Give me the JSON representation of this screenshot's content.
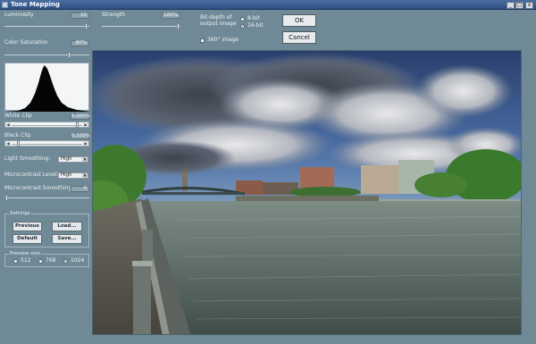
{
  "window": {
    "title": "Tone Mapping",
    "buttons": [
      "_",
      "□",
      "x"
    ]
  },
  "controls": {
    "luminosity": {
      "label": "Luminosity",
      "value": "10"
    },
    "color_saturation": {
      "label": "Color Saturation",
      "value": "80%"
    },
    "white_clip": {
      "label": "White Clip",
      "value": "5.000%"
    },
    "black_clip": {
      "label": "Black Clip",
      "value": "0.330%"
    },
    "light_smoothing": {
      "label": "Light Smoothing:",
      "value": "High"
    },
    "microcontrast_level": {
      "label": "Microcontrast Level:",
      "value": "High"
    },
    "microcontrast_smoothing": {
      "label": "Microcontrast Smoothing",
      "value": "0"
    },
    "strength": {
      "label": "Strength",
      "value": "100%"
    }
  },
  "settings": {
    "title": "Settings",
    "previous": "Previous",
    "load": "Load...",
    "default": "Default",
    "save": "Save..."
  },
  "preview_size": {
    "title": "Preview size",
    "options": [
      "512",
      "768",
      "1024"
    ],
    "selected": "1024"
  },
  "bit_depth": {
    "label_line1": "Bit-depth of",
    "label_line2": "output image",
    "options": [
      "8-bit",
      "16-bit"
    ],
    "selected": "16-bit"
  },
  "image360": {
    "label": "360° image",
    "checked": false
  },
  "actions": {
    "ok": "OK",
    "cancel": "Cancel"
  },
  "colors": {
    "window_bg": "#6f8a96",
    "titlebar": "#3a5f93"
  }
}
